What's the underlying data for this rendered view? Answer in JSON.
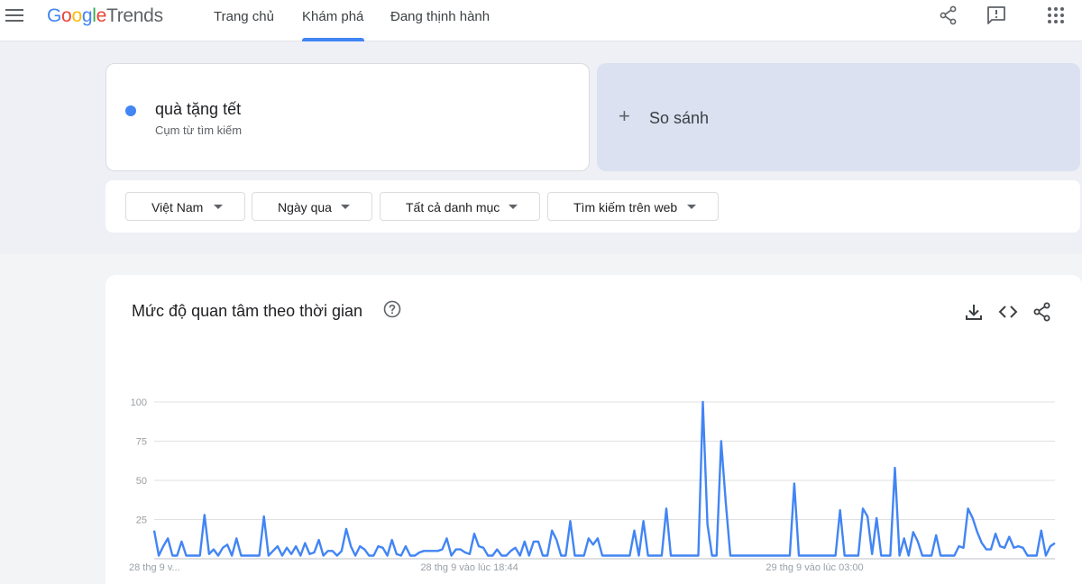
{
  "header": {
    "logo": {
      "g": "G",
      "o1": "o",
      "o2": "o",
      "g2": "g",
      "l": "l",
      "e": "e",
      "trends": "Trends"
    },
    "tabs": [
      {
        "label": "Trang chủ"
      },
      {
        "label": "Khám phá",
        "active": true
      },
      {
        "label": "Đang thịnh hành"
      }
    ],
    "icons": [
      "menu-icon",
      "share-icon",
      "feedback-icon",
      "apps-icon"
    ]
  },
  "search": {
    "term": "quà tặng tết",
    "term_type": "Cụm từ tìm kiếm",
    "term_color": "#4285f4",
    "compare_label": "So sánh",
    "compare_icon": "+"
  },
  "filters": [
    {
      "label": "Việt Nam"
    },
    {
      "label": "Ngày qua"
    },
    {
      "label": "Tất cả danh mục"
    },
    {
      "label": "Tìm kiếm trên web"
    }
  ],
  "chart_section": {
    "title": "Mức độ quan tâm theo thời gian",
    "actions": [
      "download-icon",
      "embed-icon",
      "share-icon"
    ]
  },
  "chart_data": {
    "type": "line",
    "ylim": [
      0,
      100
    ],
    "y_ticks": [
      "100",
      "75",
      "50",
      "25"
    ],
    "x_tick_labels": [
      "28 thg 9 v...",
      "28 thg 9 vào lúc 18:44",
      "29 thg 9 vào lúc 03:00"
    ],
    "x_tick_positions": [
      0,
      59,
      128
    ],
    "series": [
      {
        "color": "#4285f4",
        "values": [
          18,
          2,
          8,
          13,
          2,
          2,
          11,
          2,
          2,
          2,
          2,
          28,
          3,
          6,
          2,
          7,
          9,
          2,
          13,
          2,
          2,
          2,
          2,
          2,
          27,
          2,
          5,
          8,
          2,
          7,
          3,
          8,
          2,
          10,
          3,
          4,
          12,
          2,
          5,
          5,
          2,
          5,
          19,
          8,
          2,
          8,
          6,
          2,
          2,
          8,
          7,
          2,
          12,
          3,
          2,
          8,
          2,
          2,
          4,
          5,
          5,
          5,
          5,
          6,
          13,
          2,
          6,
          6,
          4,
          3,
          16,
          8,
          7,
          2,
          2,
          6,
          2,
          2,
          5,
          7,
          2,
          11,
          2,
          11,
          11,
          2,
          2,
          18,
          12,
          2,
          2,
          24,
          2,
          2,
          2,
          13,
          9,
          13,
          2,
          2,
          2,
          2,
          2,
          2,
          2,
          18,
          2,
          24,
          2,
          2,
          2,
          2,
          32,
          2,
          2,
          2,
          2,
          2,
          2,
          2,
          100,
          22,
          2,
          2,
          75,
          36,
          2,
          2,
          2,
          2,
          2,
          2,
          2,
          2,
          2,
          2,
          2,
          2,
          2,
          2,
          48,
          2,
          2,
          2,
          2,
          2,
          2,
          2,
          2,
          2,
          31,
          2,
          2,
          2,
          2,
          32,
          27,
          3,
          26,
          2,
          2,
          2,
          58,
          2,
          13,
          2,
          17,
          11,
          2,
          2,
          2,
          15,
          2,
          2,
          2,
          2,
          8,
          7,
          32,
          26,
          17,
          10,
          6,
          6,
          16,
          8,
          7,
          14,
          7,
          8,
          7,
          2,
          2,
          2,
          18,
          2,
          8,
          10
        ]
      }
    ]
  }
}
